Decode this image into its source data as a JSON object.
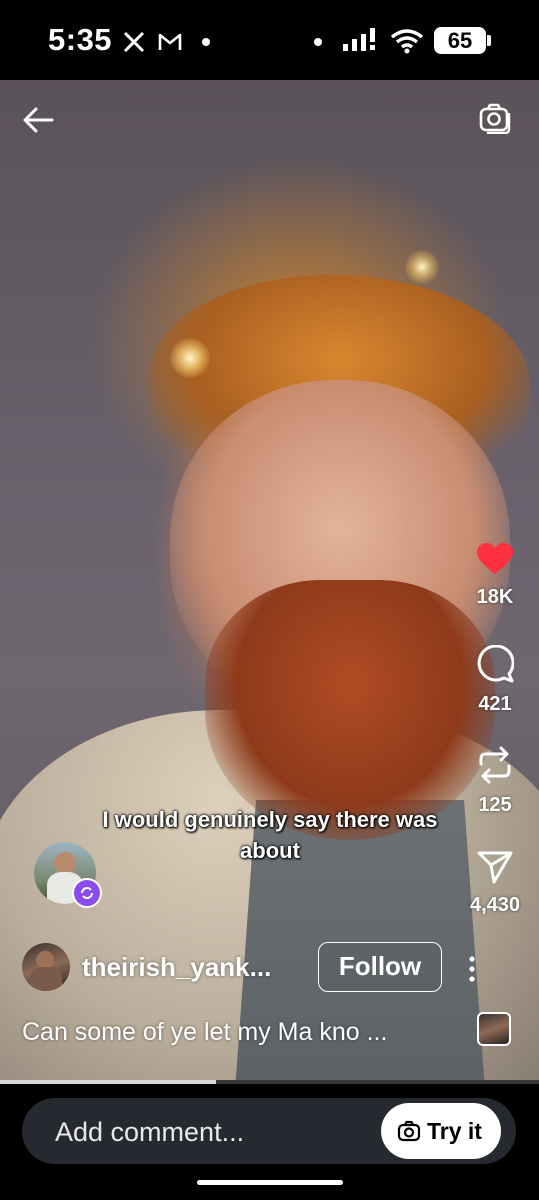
{
  "status_bar": {
    "time": "5:35",
    "battery": "65",
    "icons": [
      "x-app-icon",
      "gmail-icon",
      "notification-dot-icon",
      "notification-dot-icon",
      "signal-icon",
      "wifi-icon",
      "battery-icon"
    ]
  },
  "top_bar": {
    "icons": [
      "back-arrow-icon",
      "camera-icon"
    ]
  },
  "video": {
    "caption": "I would genuinely say there was about",
    "progress": 0.4
  },
  "actions": {
    "like_count": "18K",
    "comment_count": "421",
    "repost_count": "125",
    "share_count": "4,430",
    "like_color": "#ff3040"
  },
  "creator": {
    "username": "theirish_yank...",
    "follow_label": "Follow",
    "description": "Can some of ye let my Ma kno ...",
    "remix_badge_color": "#8a4bf0"
  },
  "comment_bar": {
    "placeholder": "Add comment...",
    "try_label": "Try it"
  }
}
